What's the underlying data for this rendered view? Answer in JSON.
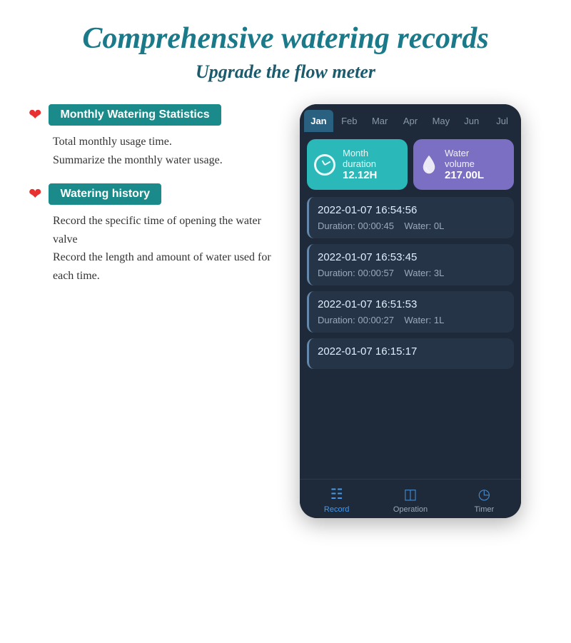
{
  "page": {
    "title": "Comprehensive watering records",
    "subtitle": "Upgrade the flow meter"
  },
  "features": [
    {
      "id": "monthly",
      "badge": "Monthly Watering Statistics",
      "description_lines": [
        "Total monthly usage time.",
        "Summarize the monthly water usage."
      ]
    },
    {
      "id": "history",
      "badge": "Watering history",
      "description_lines": [
        "Record the specific time of opening the water valve",
        "Record the length and amount of water used for each time."
      ]
    }
  ],
  "phone": {
    "months": [
      "Jan",
      "Feb",
      "Mar",
      "Apr",
      "May",
      "Jun",
      "Jul"
    ],
    "active_month": "Jan",
    "stats": [
      {
        "type": "teal",
        "icon": "clock",
        "label": "Month\nduration",
        "value": "12.12H"
      },
      {
        "type": "purple",
        "icon": "droplet",
        "label": "Water\nvolume",
        "value": "217.00L"
      }
    ],
    "history": [
      {
        "datetime": "2022-01-07 16:54:56",
        "duration": "00:00:45",
        "water": "0L"
      },
      {
        "datetime": "2022-01-07 16:53:45",
        "duration": "00:00:57",
        "water": "3L"
      },
      {
        "datetime": "2022-01-07 16:51:53",
        "duration": "00:00:27",
        "water": "1L"
      },
      {
        "datetime": "2022-01-07 16:15:17",
        "duration": "",
        "water": ""
      }
    ],
    "nav_items": [
      {
        "label": "Record",
        "active": true
      },
      {
        "label": "Operation",
        "active": false
      },
      {
        "label": "Timer",
        "active": false
      }
    ],
    "labels": {
      "duration_prefix": "Duration: ",
      "water_prefix": "    Water: "
    }
  }
}
